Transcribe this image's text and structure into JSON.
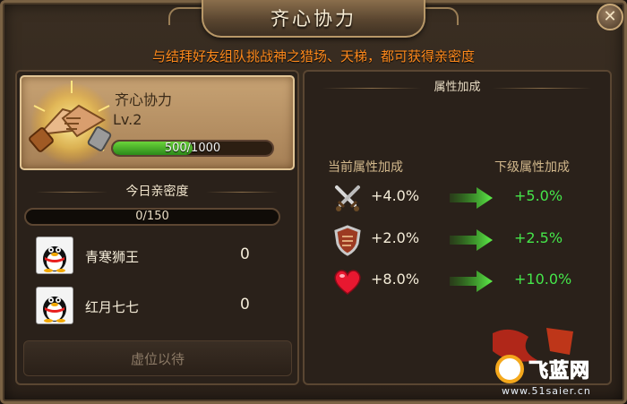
{
  "window": {
    "title": "齐心协力",
    "close_icon": "close-icon"
  },
  "notice": "与结拜好友组队挑战神之猎场、天梯，都可获得亲密度",
  "skill": {
    "name": "齐心协力",
    "level": "Lv.2",
    "exp_text": "500/1000",
    "exp_fraction": 0.5,
    "icon": "handshake-icon"
  },
  "daily": {
    "heading": "今日亲密度",
    "progress_text": "0/150",
    "progress_fraction": 0
  },
  "friends": [
    {
      "name": "青寒狮王",
      "value": "0",
      "avatar": "qq-penguin-avatar"
    },
    {
      "name": "红月七七",
      "value": "0",
      "avatar": "qq-penguin-avatar"
    }
  ],
  "vacant_label": "虚位以待",
  "attributes": {
    "heading": "属性加成",
    "current_header": "当前属性加成",
    "next_header": "下级属性加成",
    "rows": [
      {
        "icon": "crossed-swords-icon",
        "current": "+4.0%",
        "next": "+5.0%"
      },
      {
        "icon": "shield-icon",
        "current": "+2.0%",
        "next": "+2.5%"
      },
      {
        "icon": "heart-icon",
        "current": "+8.0%",
        "next": "+10.0%"
      }
    ]
  },
  "watermark": {
    "main": "飞蓝网",
    "url": "www.51saier.cn"
  },
  "colors": {
    "notice": "#ff8a1c",
    "next_value": "#45e64a",
    "exp_fill": "#4cb82a"
  }
}
